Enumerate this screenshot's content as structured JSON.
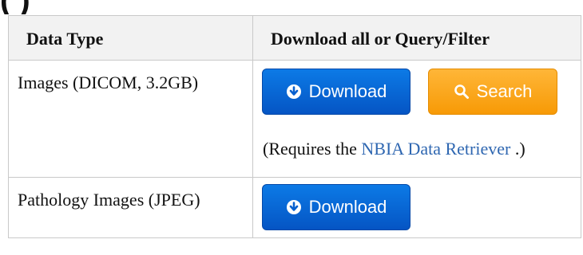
{
  "heading_fragment": "(         )",
  "table": {
    "headers": [
      "Data Type",
      "Download all or Query/Filter"
    ],
    "rows": [
      {
        "type": "Images (DICOM, 3.2GB)",
        "download_label": "Download",
        "search_label": "Search",
        "note_prefix": "(Requires the ",
        "note_link": "NBIA Data Retriever",
        "note_suffix": " .)"
      },
      {
        "type": "Pathology Images (JPEG)",
        "download_label": "Download"
      }
    ]
  },
  "icons": {
    "download": "circle-down-arrow-icon",
    "search": "magnifier-icon"
  },
  "colors": {
    "download_button": "#0a67d6",
    "search_button": "#f9a520",
    "link": "#2f67b1",
    "header_bg": "#f2f2f2",
    "border": "#c9c9c9"
  }
}
